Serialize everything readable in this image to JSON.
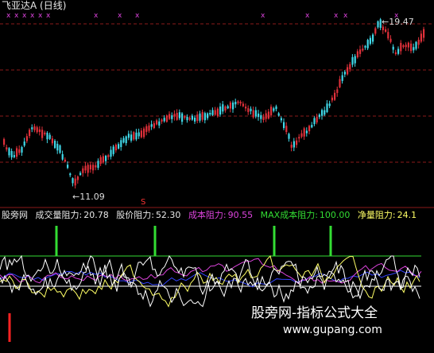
{
  "title": "飞亚达A (日线)",
  "colors": {
    "up": "#e0303a",
    "down": "#40d8e8",
    "grid_dash": "#8b1a1a",
    "green": "#33dd33",
    "magenta": "#dd44dd",
    "blue": "#3344ff",
    "white": "#ffffff",
    "yellow": "#ffff66",
    "red": "#ff2222"
  },
  "price_panel": {
    "high_marker": "19.47",
    "low_marker": "11.09",
    "signal_mark": "S",
    "top_markers": "xx"
  },
  "indicator_bar": {
    "source": "股旁网",
    "items": [
      {
        "label": "成交量阻力:",
        "value": "20.78",
        "color": "#e8e8e8"
      },
      {
        "label": "股价阻力:",
        "value": "52.30",
        "color": "#e8e8e8"
      },
      {
        "label": "成本阻力:",
        "value": "90.55",
        "color": "#dd44dd"
      },
      {
        "label": "MAX成本阻力:",
        "value": "100.00",
        "color": "#33dd33"
      },
      {
        "label": "净量阻力:",
        "value": "24.1",
        "color": "#ffff66"
      }
    ]
  },
  "watermark": {
    "line1": "股旁网-指标公式大全",
    "line2": "www.gupang.com"
  }
}
